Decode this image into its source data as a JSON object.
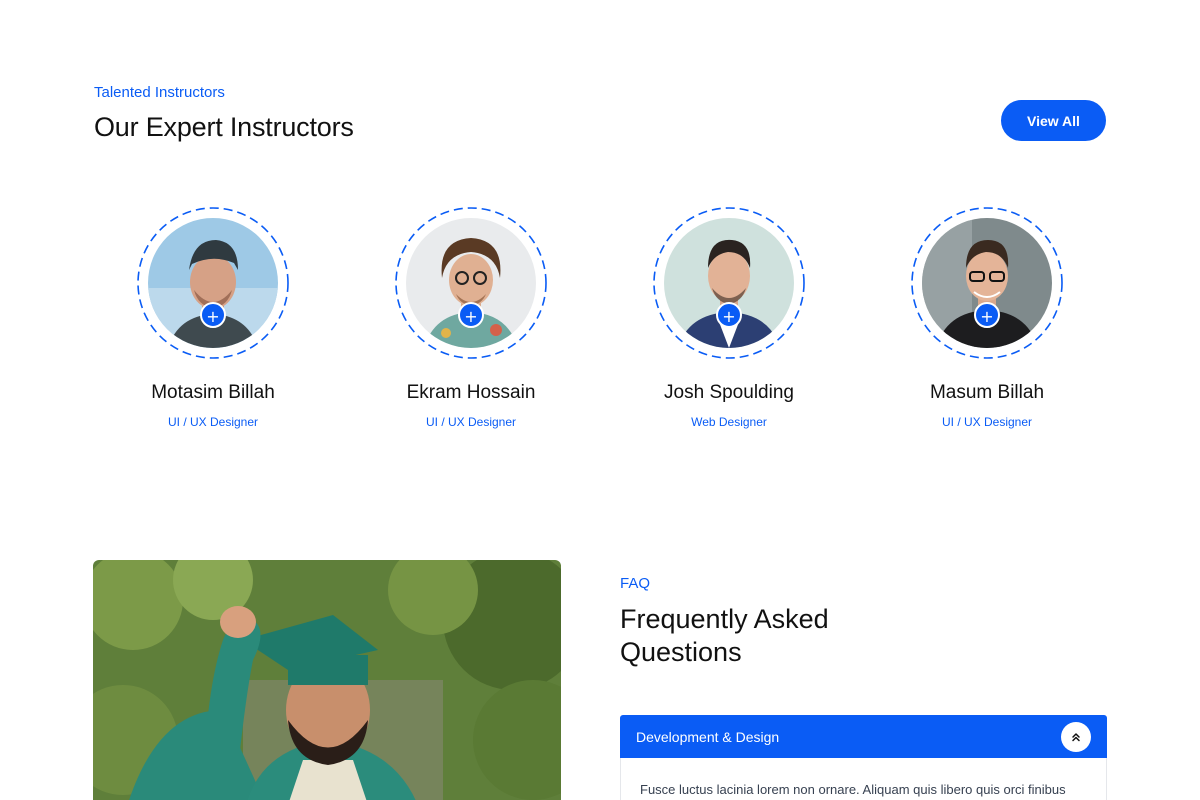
{
  "instructors_section": {
    "tag": "Talented Instructors",
    "title": "Our Expert Instructors",
    "view_all_label": "View All",
    "plus_glyph": "+",
    "items": [
      {
        "name": "Motasim Billah",
        "role": "UI / UX Designer"
      },
      {
        "name": "Ekram Hossain",
        "role": "UI / UX Designer"
      },
      {
        "name": "Josh Spoulding",
        "role": "Web Designer"
      },
      {
        "name": "Masum Billah",
        "role": "UI / UX Designer"
      }
    ]
  },
  "faq_section": {
    "tag": "FAQ",
    "title": "Frequently Asked Questions",
    "accordion": {
      "active_label": "Development & Design",
      "active_text": "Fusce luctus lacinia lorem non ornare. Aliquam quis libero quis orci finibus",
      "toggle_icon": "chevron-double-up-icon"
    }
  },
  "colors": {
    "accent": "#0a5cf5",
    "heading": "#111111",
    "body": "#374151"
  }
}
